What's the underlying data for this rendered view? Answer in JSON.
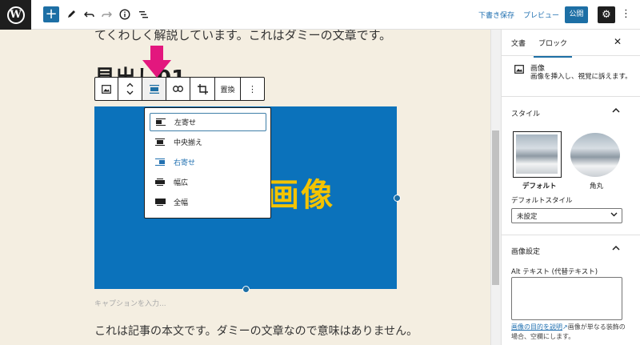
{
  "toolbar": {
    "add_label": "+",
    "save_draft": "下書き保存",
    "preview": "プレビュー",
    "publish": "公開"
  },
  "editor": {
    "intro_text": "てくわしく解説しています。これはダミーの文章です。",
    "heading": "見出し01",
    "image_text": "画像",
    "caption_placeholder": "キャプションを入力...",
    "body_text": "これは記事の本文です。ダミーの文章なので意味はありません。",
    "block_toolbar": {
      "replace_label": "置換"
    },
    "align_menu": {
      "items": [
        {
          "label": "左寄せ",
          "icon": "align-left-icon",
          "state": "focused"
        },
        {
          "label": "中央揃え",
          "icon": "align-center-icon",
          "state": "normal"
        },
        {
          "label": "右寄せ",
          "icon": "align-right-icon",
          "state": "selected"
        },
        {
          "label": "幅広",
          "icon": "align-wide-icon",
          "state": "normal"
        },
        {
          "label": "全幅",
          "icon": "align-full-icon",
          "state": "normal"
        }
      ]
    }
  },
  "sidebar": {
    "tabs": [
      "文書",
      "ブロック"
    ],
    "active_tab": "ブロック",
    "block_card": {
      "title": "画像",
      "description": "画像を挿入し、視覚に訴えます。"
    },
    "styles": {
      "title": "スタイル",
      "options": [
        "デフォルト",
        "角丸"
      ],
      "selected": "デフォルト",
      "default_style_label": "デフォルトスタイル",
      "default_style_value": "未設定"
    },
    "image_settings": {
      "title": "画像設定",
      "alt_label": "Alt テキスト (代替テキスト)",
      "alt_value": "",
      "help_link": "画像の目的を説明",
      "help_text": "画像が単なる装飾の場合、空欄にします。"
    }
  },
  "colors": {
    "accent": "#1d6fa5",
    "image_background": "#0b72bb",
    "image_text": "#f3c300",
    "arrow": "#e3177e",
    "content_background": "#f4eee1"
  }
}
